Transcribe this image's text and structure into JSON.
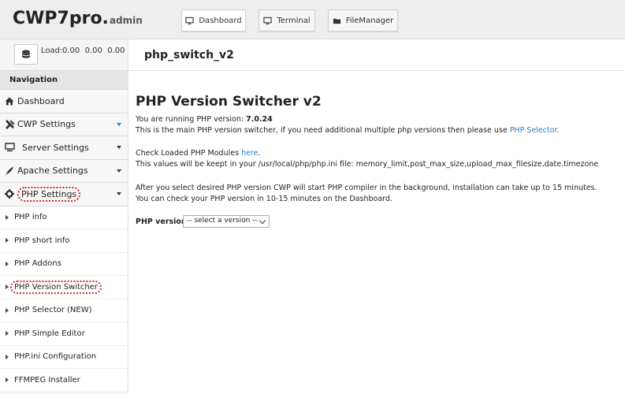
{
  "header": {
    "brand": "CWP7pro.",
    "brand_sub": "admin",
    "buttons": [
      {
        "label": "Dashboard",
        "icon": "monitor-icon"
      },
      {
        "label": "Terminal",
        "icon": "monitor-icon"
      },
      {
        "label": "FileManager",
        "icon": "folder-icon"
      }
    ]
  },
  "load": {
    "label": "Load:",
    "values": "0.00  0.00  0.00"
  },
  "page_title": "php_switch_v2",
  "sidebar": {
    "heading": "Navigation",
    "items": [
      {
        "label": "Dashboard",
        "icon": "home-icon"
      },
      {
        "label": "CWP Settings",
        "icon": "tools-icon"
      },
      {
        "label": "Server Settings",
        "icon": "server-icon"
      },
      {
        "label": "Apache Settings",
        "icon": "feather-icon"
      },
      {
        "label": "PHP Settings",
        "icon": "gear-icon"
      }
    ],
    "sub_items": [
      {
        "label": "PHP info"
      },
      {
        "label": "PHP short info"
      },
      {
        "label": "PHP Addons"
      },
      {
        "label": "PHP Version Switcher"
      },
      {
        "label": "PHP Selector (NEW)"
      },
      {
        "label": "PHP Simple Editor"
      },
      {
        "label": "PHP.ini Configuration"
      },
      {
        "label": "FFMPEG Installer"
      }
    ]
  },
  "main": {
    "title": "PHP Version Switcher v2",
    "running_prefix": "You are running PHP version: ",
    "running_version": "7.0.24",
    "desc_prefix": "This is the main PHP version switcher, if you need additional multiple php versions then please use ",
    "desc_link": "PHP Selector",
    "desc_suffix": ".",
    "modules_prefix": "Check Loaded PHP Modules ",
    "modules_link": "here",
    "modules_suffix": ".",
    "values_line": "This values will be keept in your /usr/local/php/php.ini file: memory_limit,post_max_size,upload_max_filesize,date.timezone",
    "install_line1": "After you select desired PHP version CWP will start PHP compiler in the background, installation can take up to 15 minutes.",
    "install_line2": "You can check your PHP version in 10-15 minutes on the Dashboard.",
    "version_label": "PHP version:",
    "select_value": "-- select a version --"
  },
  "colors": {
    "link": "#2a7fc1",
    "highlight": "#d9262c"
  }
}
